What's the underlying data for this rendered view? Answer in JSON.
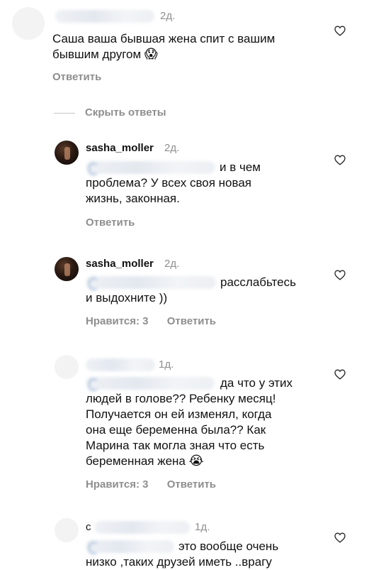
{
  "comments": [
    {
      "username": "",
      "age": "2д.",
      "lines": [
        "Саша ваша бывшая жена спит с вашим",
        "бывшим другом"
      ],
      "emoji": "😱",
      "reply_label": "Ответить"
    },
    {
      "username": "sasha_moller",
      "age": "2д.",
      "lines": [
        "и в чем",
        "проблема? У всех своя новая",
        "жизнь, законная."
      ],
      "reply_label": "Ответить"
    },
    {
      "username": "sasha_moller",
      "age": "2д.",
      "lines": [
        "расслабьтесь",
        "и выдохните ))"
      ],
      "likes_label": "Нравится: 3",
      "reply_label": "Ответить"
    },
    {
      "username": "",
      "age": "1д.",
      "lines": [
        "да что у этих",
        "людей в голове?? Ребенку месяц!",
        "Получается он ей изменял, когда",
        "она еще беременна была?? Как",
        "Марина так могла зная что есть",
        "беременная жена"
      ],
      "emoji": "😭",
      "likes_label": "Нравится: 3",
      "reply_label": "Ответить"
    },
    {
      "username": "с",
      "age": "1д.",
      "lines": [
        "это вообще очень",
        "низко ,таких друзей иметь ..врагу"
      ]
    }
  ],
  "thread": {
    "hide_replies_label": "Скрыть ответы"
  },
  "icons": {
    "like": "heart-outline-icon"
  },
  "colors": {
    "secondary_text": "#8e8e8e",
    "primary_text": "#111111"
  }
}
